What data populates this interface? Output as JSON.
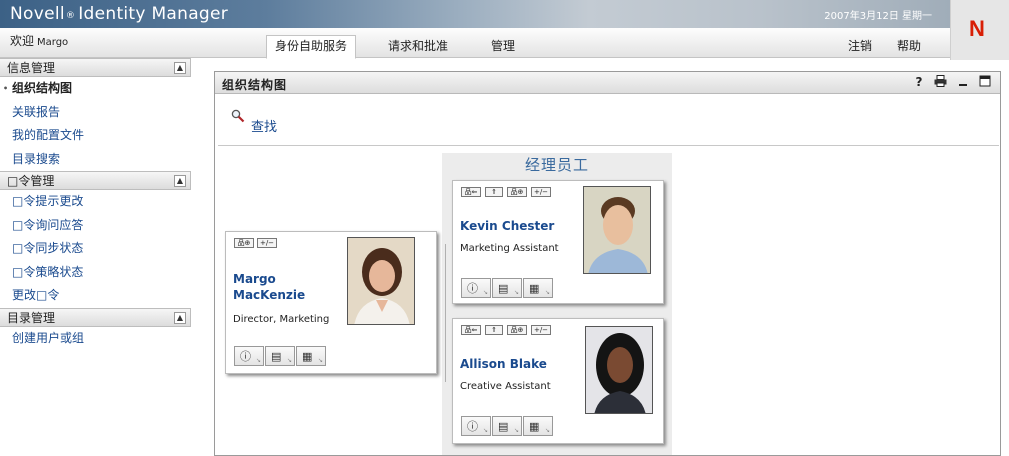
{
  "header": {
    "brand_name": "Novell",
    "brand_reg": "®",
    "brand_product": "Identity Manager",
    "date_text": "2007年3月12日  星期一",
    "logo_letter": "N",
    "welcome_label": "欢迎",
    "welcome_user": "Margo",
    "tabs": [
      {
        "label": "身份自助服务",
        "active": true
      },
      {
        "label": "请求和批准",
        "active": false
      },
      {
        "label": "管理",
        "active": false
      }
    ],
    "logout_label": "注销",
    "help_label": "帮助"
  },
  "sidebar": {
    "sections": [
      {
        "title": "信息管理",
        "items": [
          "组织结构图",
          "关联报告",
          "我的配置文件",
          "目录搜索"
        ]
      },
      {
        "title": "□令管理",
        "items": [
          "□令提示更改",
          "□令询问应答",
          "□令同步状态",
          "□令策略状态",
          "更改□令"
        ]
      },
      {
        "title": "目录管理",
        "items": [
          "创建用户或组"
        ]
      }
    ],
    "current_item": "组织结构图"
  },
  "portlet": {
    "title": "组织结构图",
    "help_icon_label": "?",
    "search_label": "查找"
  },
  "orgchart": {
    "reports_title": "经理员工",
    "mini_buttons": {
      "manager": "品⇐",
      "up": "⇑",
      "expand": "品⊕",
      "toggle": "+/−"
    },
    "manager": {
      "first": "Margo",
      "last": "MacKenzie",
      "title": "Director, Marketing"
    },
    "reports": [
      {
        "name": "Kevin Chester",
        "title": "Marketing Assistant"
      },
      {
        "name": "Allison Blake",
        "title": "Creative Assistant"
      }
    ]
  },
  "colors": {
    "brand_blue": "#3c6186",
    "link_blue": "#1a4a8e",
    "novell_red": "#d81e05"
  }
}
